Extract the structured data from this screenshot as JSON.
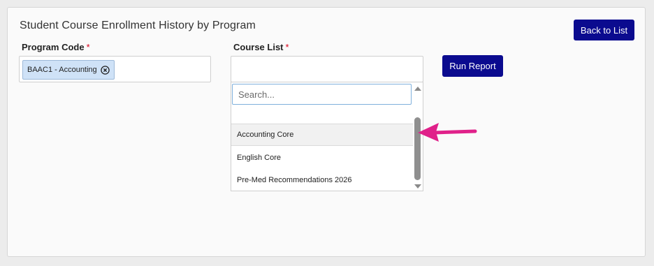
{
  "page": {
    "title": "Student Course Enrollment History by Program",
    "back_button": "Back to List",
    "run_button": "Run Report"
  },
  "program": {
    "label": "Program Code",
    "required_mark": "*",
    "selected_chip": "BAAC1 - Accounting"
  },
  "course": {
    "label": "Course List",
    "required_mark": "*",
    "search_placeholder": "Search...",
    "options": [
      "Accounting Core",
      "English Core",
      "Pre-Med Recommendations 2026"
    ]
  },
  "colors": {
    "primary_button": "#0b0b8f",
    "chip_bg": "#cfe2f7",
    "required": "#d9001b",
    "annotation_arrow": "#e0218a"
  }
}
